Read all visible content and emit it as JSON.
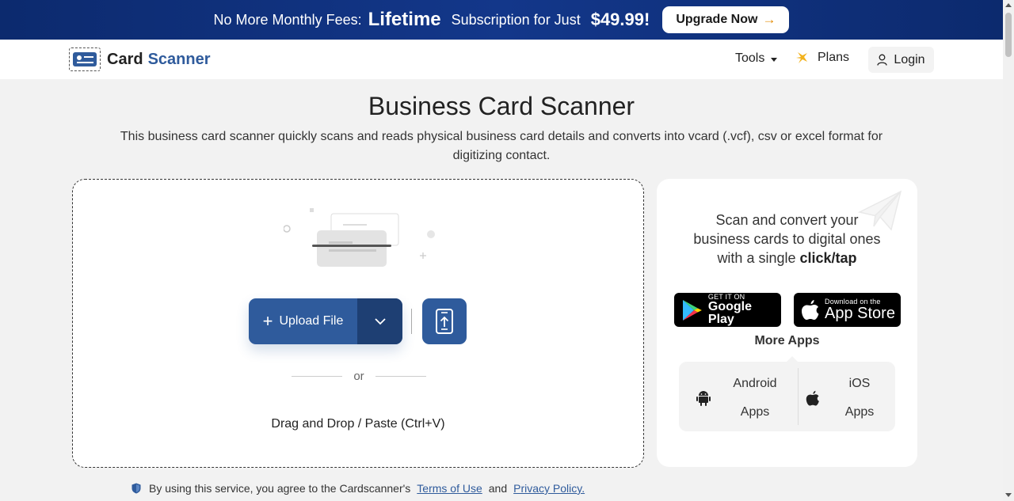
{
  "promo": {
    "prefix": "No More Monthly Fees:",
    "highlight": "Lifetime",
    "middle": "Subscription for Just",
    "price": "$49.99!",
    "cta": "Upgrade Now",
    "cta_arrow": "→"
  },
  "nav": {
    "brand_part1": "Card",
    "brand_part2": "Scanner",
    "tools": "Tools",
    "plans": "Plans",
    "login": "Login"
  },
  "page": {
    "title": "Business Card Scanner",
    "subtitle": "This business card scanner quickly scans and reads physical business card details and converts into vcard (.vcf), csv or excel format for digitizing contact."
  },
  "upload": {
    "button_label": "Upload File",
    "or": "or",
    "dnd_text": "Drag and Drop / Paste (Ctrl+V)"
  },
  "side": {
    "text_plain": "Scan and convert your business cards to digital ones with a single ",
    "text_bold": "click/tap",
    "google_small": "GET IT ON",
    "google_big": "Google Play",
    "apple_small": "Download on the",
    "apple_big": "App Store",
    "more_apps": "More Apps",
    "android_l1": "Android",
    "android_l2": "Apps",
    "ios_l1": "iOS",
    "ios_l2": "Apps"
  },
  "footer": {
    "agree": "By using this service, you agree to the Cardscanner's",
    "terms": "Terms of Use",
    "and": "and",
    "privacy": "Privacy Policy."
  },
  "colors": {
    "brand": "#2f5b9c",
    "banner": "#13378a",
    "accent": "#e38a00"
  },
  "icons": [
    "id-card-icon",
    "caret-down-icon",
    "sparkle-icon",
    "user-icon",
    "plus-icon",
    "chevron-down-icon",
    "mobile-upload-icon",
    "paper-plane-icon",
    "google-play-icon",
    "apple-icon",
    "android-icon",
    "shield-icon"
  ]
}
